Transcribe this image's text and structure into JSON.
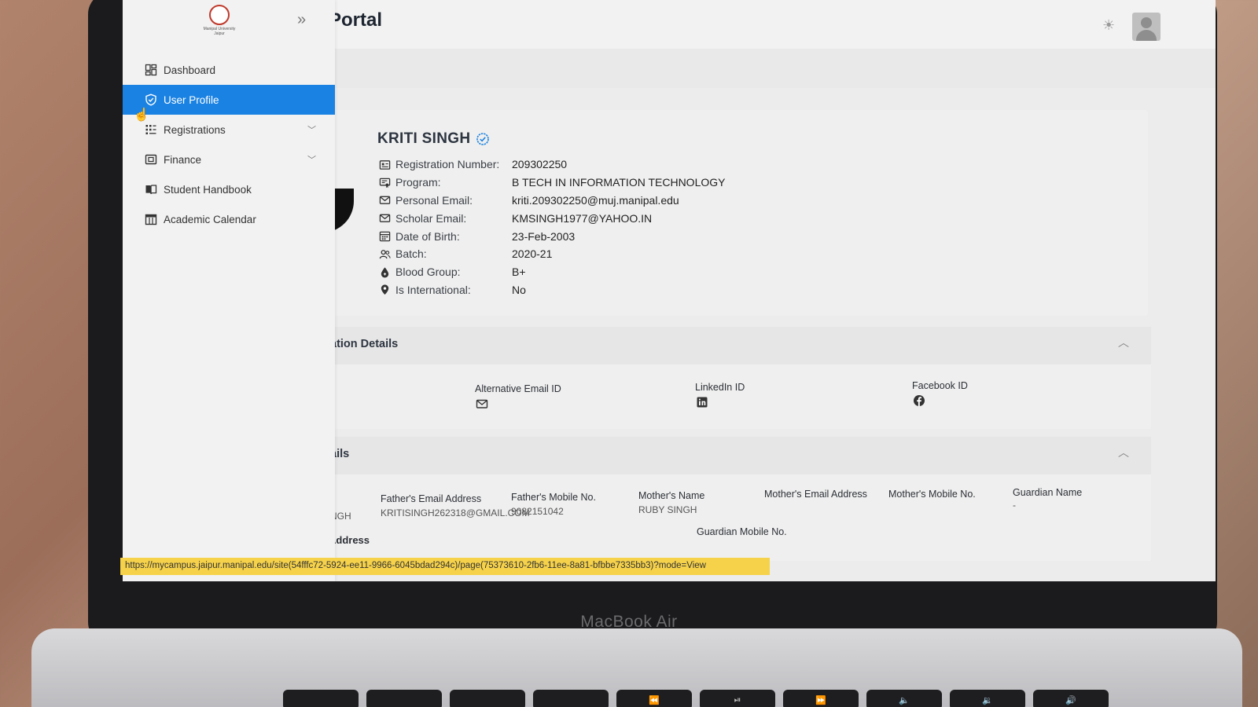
{
  "header": {
    "title": "Portal"
  },
  "logo": {
    "caption": "Manipal University Jaipur"
  },
  "sidebar": {
    "items": [
      {
        "label": "Dashboard",
        "icon": "dashboard-icon"
      },
      {
        "label": "User Profile",
        "icon": "shield-check-icon",
        "active": true
      },
      {
        "label": "Registrations",
        "icon": "grid-list-icon",
        "expandable": true
      },
      {
        "label": "Finance",
        "icon": "wallet-icon",
        "expandable": true
      },
      {
        "label": "Student Handbook",
        "icon": "book-icon"
      },
      {
        "label": "Academic Calendar",
        "icon": "calendar-icon"
      }
    ]
  },
  "profile": {
    "name": "KRITI SINGH",
    "rows": [
      {
        "label": "Registration Number:",
        "value": "209302250",
        "icon": "id-card-icon"
      },
      {
        "label": "Program:",
        "value": "B TECH IN INFORMATION TECHNOLOGY",
        "icon": "certificate-icon"
      },
      {
        "label": "Personal Email:",
        "value": "kriti.209302250@muj.manipal.edu",
        "icon": "envelope-icon"
      },
      {
        "label": "Scholar Email:",
        "value": "KMSINGH1977@YAHOO.IN",
        "icon": "envelope-icon"
      },
      {
        "label": "Date of Birth:",
        "value": "23-Feb-2003",
        "icon": "calendar-icon"
      },
      {
        "label": "Batch:",
        "value": "2020-21",
        "icon": "users-icon"
      },
      {
        "label": "Blood Group:",
        "value": "B+",
        "icon": "blood-drop-icon"
      },
      {
        "label": "Is International:",
        "value": "No",
        "icon": "location-pin-icon"
      }
    ]
  },
  "contact_section": {
    "title": "ation Details",
    "fields": [
      {
        "label": "Alternative Email ID",
        "icon": "envelope-icon"
      },
      {
        "label": "LinkedIn ID",
        "icon": "linkedin-icon"
      },
      {
        "label": "Facebook ID",
        "icon": "facebook-icon"
      }
    ]
  },
  "parent_section": {
    "title": "ails",
    "partial_value": "NGH",
    "fathers_email_label": "Father's Email Address",
    "fathers_email_value": "KRITISINGH262318@GMAIL.COM",
    "fathers_mobile_label": "Father's Mobile No.",
    "fathers_mobile_value": "9082151042",
    "mothers_name_label": "Mother's Name",
    "mothers_name_value": "RUBY SINGH",
    "mothers_email_label": "Mother's Email Address",
    "mothers_mobile_label": "Mother's Mobile No.",
    "guardian_name_label": "Guardian Name",
    "guardian_name_value": "-",
    "address_label": "Address",
    "guardian_mobile_label": "Guardian Mobile No."
  },
  "status_bar": {
    "url": "https://mycampus.jaipur.manipal.edu/site(54fffc72-5924-ee11-9966-6045bdad294c)/page(75373610-2fb6-11ee-8a81-bfbbe7335bb3)?mode=View"
  },
  "device": {
    "brand_label": "MacBook Air"
  },
  "colors": {
    "accent": "#1a82e2",
    "status_bar": "#f6d24a"
  }
}
